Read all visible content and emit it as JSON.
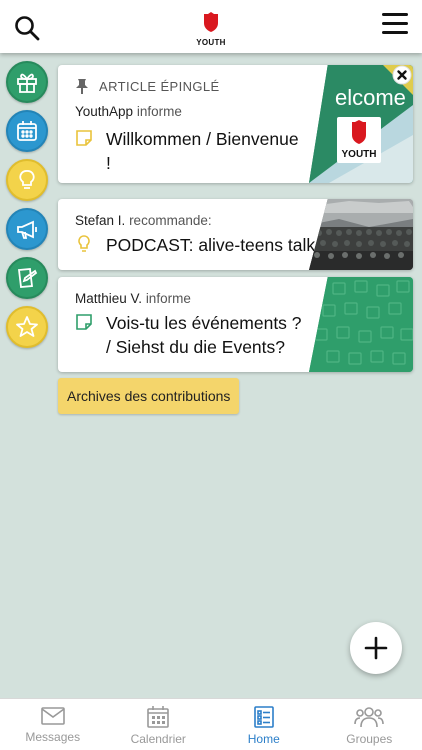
{
  "header": {
    "logo_text": "YOUTH"
  },
  "sidebar": {
    "items": [
      {
        "name": "gift",
        "color": "#2f9e6b"
      },
      {
        "name": "calendar",
        "color": "#2c97cf"
      },
      {
        "name": "lightbulb",
        "color": "#f3d34a"
      },
      {
        "name": "megaphone",
        "color": "#2c97cf"
      },
      {
        "name": "note-edit",
        "color": "#2f9e6b"
      },
      {
        "name": "star",
        "color": "#f3d34a"
      }
    ]
  },
  "pinned": {
    "label": "ARTICLE ÉPINGLÉ",
    "author": "YouthApp",
    "verb": "informe",
    "title": "Willkommen / Bienvenue !",
    "thumb_text": "elcome",
    "thumb_logo": "YOUTH"
  },
  "posts": [
    {
      "author": "Stefan I.",
      "verb": "recommande:",
      "title": "PODCAST: alive-teens talk",
      "icon": "lightbulb-icon"
    },
    {
      "author": "Matthieu V.",
      "verb": "informe",
      "title": "Vois-tu les événements ? / Siehst du die Events?",
      "icon": "note-icon"
    }
  ],
  "archive_label": "Archives des contributions",
  "tabs": [
    {
      "label": "Messages",
      "icon": "mail-icon",
      "active": false
    },
    {
      "label": "Calendrier",
      "icon": "calendar-icon",
      "active": false
    },
    {
      "label": "Home",
      "icon": "list-icon",
      "active": true
    },
    {
      "label": "Groupes",
      "icon": "group-icon",
      "active": false
    }
  ],
  "colors": {
    "accent": "#2c7fc9",
    "green": "#2f9e6b",
    "blue": "#2c97cf",
    "yellow": "#f3d34a",
    "background": "#d3e1dc",
    "brand_red": "#d9181f"
  }
}
